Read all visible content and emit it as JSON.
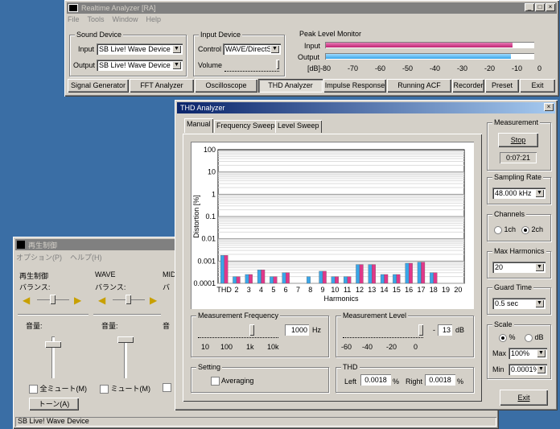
{
  "ra": {
    "title": "Realtime Analyzer [RA]",
    "menu": [
      "File",
      "Tools",
      "Window",
      "Help"
    ],
    "sound_device": {
      "label": "Sound Device",
      "input_label": "Input",
      "input_value": "SB Live! Wave Device",
      "output_label": "Output",
      "output_value": "SB Live! Wave Device"
    },
    "input_device": {
      "label": "Input Device",
      "control_label": "Control",
      "control_value": "WAVE/DirectS",
      "volume_label": "Volume"
    },
    "peak": {
      "label": "Peak Level Monitor",
      "input_label": "Input",
      "output_label": "Output",
      "unit": "[dB]",
      "ticks": [
        "-80",
        "-70",
        "-60",
        "-50",
        "-40",
        "-30",
        "-20",
        "-10",
        "0"
      ],
      "input_level": 0.9,
      "output_level": 0.89
    },
    "toolbar": [
      "Signal Generator",
      "FFT Analyzer",
      "Oscilloscope",
      "THD Analyzer",
      "Impulse Response",
      "Running ACF",
      "Recorder",
      "Preset",
      "Exit"
    ]
  },
  "thd": {
    "title": "THD Analyzer",
    "tabs": [
      "Manual",
      "Frequency Sweep",
      "Level Sweep"
    ],
    "measurement": {
      "label": "Measurement",
      "stop": "Stop",
      "time": "0:07:21"
    },
    "sampling": {
      "label": "Sampling Rate",
      "value": "48.000 kHz"
    },
    "channels": {
      "label": "Channels",
      "opt1": "1ch",
      "opt2": "2ch"
    },
    "max_harmonics": {
      "label": "Max Harmonics",
      "value": "20"
    },
    "guard": {
      "label": "Guard Time",
      "value": "0.5 sec"
    },
    "scale": {
      "label": "Scale",
      "pct": "%",
      "db": "dB",
      "max_label": "Max",
      "max_value": "100%",
      "min_label": "Min",
      "min_value": "0.0001%"
    },
    "exit": "Exit",
    "freq": {
      "label": "Measurement Frequency",
      "value": "1000",
      "unit": "Hz",
      "ticks": [
        "10",
        "100",
        "1k",
        "10k"
      ]
    },
    "level": {
      "label": "Measurement Level",
      "value": "13",
      "unit": "dB",
      "ticks": [
        "-60",
        "-40",
        "-20",
        "0"
      ]
    },
    "setting": {
      "label": "Setting",
      "averaging": "Averaging"
    },
    "thd_box": {
      "label": "THD",
      "left_label": "Left",
      "left_value": "0.0018",
      "right_label": "Right",
      "right_value": "0.0018",
      "unit": "%"
    }
  },
  "chart_data": {
    "type": "bar",
    "title": "",
    "xlabel": "Harmonics",
    "ylabel": "Distortion [%]",
    "y_scale": "log",
    "ylim": [
      0.0001,
      100
    ],
    "y_ticks": [
      "100",
      "10",
      "1",
      "0.1",
      "0.01",
      "0.001",
      "0.0001"
    ],
    "categories": [
      "THD",
      "2",
      "3",
      "4",
      "5",
      "6",
      "7",
      "8",
      "9",
      "10",
      "11",
      "12",
      "13",
      "14",
      "15",
      "16",
      "17",
      "18",
      "19",
      "20"
    ],
    "series": [
      {
        "color": "#3aa6e8",
        "values": [
          0.0018,
          0.0002,
          0.00025,
          0.0004,
          0.0002,
          0.0003,
          0.0001,
          0.0002,
          0.00035,
          0.0002,
          0.0002,
          0.0007,
          0.0007,
          0.00025,
          0.00025,
          0.0008,
          0.0009,
          0.0003,
          0.0001,
          0.0001
        ]
      },
      {
        "color": "#e0388a",
        "values": [
          0.0018,
          0.0002,
          0.00025,
          0.0004,
          0.0002,
          0.0003,
          0.0001,
          0.0001,
          0.00035,
          0.0002,
          0.0002,
          0.0007,
          0.0007,
          0.00025,
          0.00025,
          0.0008,
          0.0009,
          0.0003,
          0.0001,
          0.0001
        ]
      }
    ],
    "grid": true
  },
  "mixer": {
    "title": "再生制御",
    "menu": [
      "オプション(P)",
      "ヘルプ(H)"
    ],
    "cols": [
      {
        "title": "再生制御",
        "balance": "バランス:",
        "volume": "音量:",
        "mute": "全ミュート(M)"
      },
      {
        "title": "WAVE",
        "balance": "バランス:",
        "volume": "音量:",
        "mute": "ミュート(M)"
      },
      {
        "title": "MID",
        "balance": "バ",
        "volume": "音",
        "mute": ""
      }
    ],
    "tone": "トーン(A)",
    "status": "SB Live! Wave Device"
  }
}
